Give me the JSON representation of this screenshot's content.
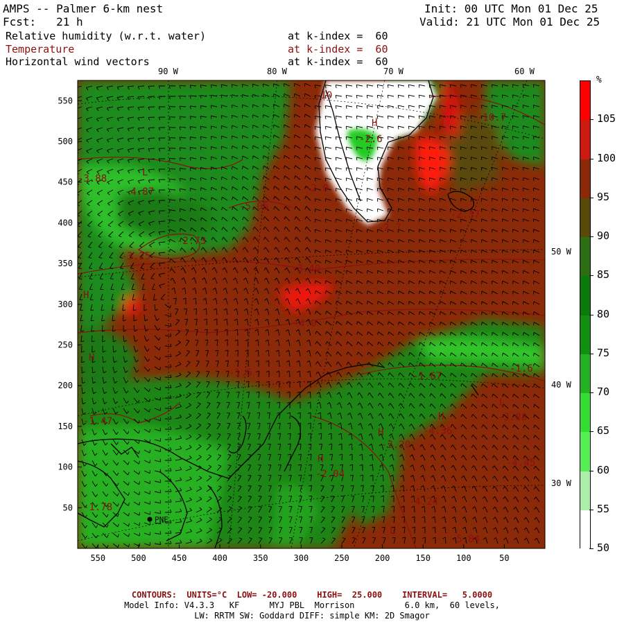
{
  "header": {
    "model_title": "AMPS -- Palmer 6-km nest",
    "forecast": "Fcst:   21 h",
    "init": "Init: 00 UTC Mon 01 Dec 25",
    "valid": "Valid: 21 UTC Mon 01 Dec 25"
  },
  "fields": [
    {
      "label": "Relative humidity (w.r.t. water)",
      "level": "at k-index =  60",
      "color": "#000000"
    },
    {
      "label": "Temperature",
      "level": "at k-index =  60",
      "color": "#8b1010"
    },
    {
      "label": "Horizontal wind vectors",
      "level": "at k-index =  60",
      "color": "#000000"
    }
  ],
  "map": {
    "x_ticks": [
      "550",
      "500",
      "450",
      "400",
      "350",
      "300",
      "250",
      "200",
      "150",
      "100",
      "50"
    ],
    "y_ticks": [
      "550",
      "500",
      "450",
      "400",
      "350",
      "300",
      "250",
      "200",
      "150",
      "100",
      "50"
    ],
    "longitude_labels_top": [
      "90 W",
      "80 W",
      "70 W",
      "60 W"
    ],
    "longitude_labels_right": [
      "50 W",
      "40 W",
      "30 W"
    ],
    "station_label": "PNE",
    "contour_labels": [
      "-10",
      "-2.6",
      "-4.87",
      "-3.25",
      "-5.06",
      "-2.73",
      "-3.40",
      "-1.67",
      "-1.6",
      "-3.88",
      "-4.36",
      "-3.20",
      "-2.04",
      "-4.24",
      "-4.45",
      "-5.84",
      "-10.7",
      "-2.37",
      "-1.47",
      "-1.78",
      "-3.88",
      "-4.0",
      "-2.0",
      "-2.7",
      "-1.6"
    ],
    "high_low_markers": [
      "H",
      "L"
    ]
  },
  "colorbar": {
    "unit": "%",
    "labels": [
      "105",
      "100",
      "95",
      "90",
      "85",
      "80",
      "75",
      "70",
      "65",
      "60",
      "55",
      "50"
    ],
    "colors": [
      "#ff0000",
      "#cc1a10",
      "#8b2a08",
      "#5a4a08",
      "#2d6e14",
      "#0a7a0a",
      "#118f11",
      "#22b222",
      "#33dd33",
      "#55ee55",
      "#aaeeaa",
      "#ffffff"
    ]
  },
  "footer": {
    "contours": "CONTOURS:  UNITS=°C  LOW= -20.000    HIGH=  25.000    INTERVAL=   5.0000",
    "model_info": "Model Info: V4.3.3   KF      MYJ PBL  Morrison          6.0 km,  60 levels,",
    "physics": "LW: RRTM SW: Goddard DIFF: simple KM: 2D Smagor"
  }
}
